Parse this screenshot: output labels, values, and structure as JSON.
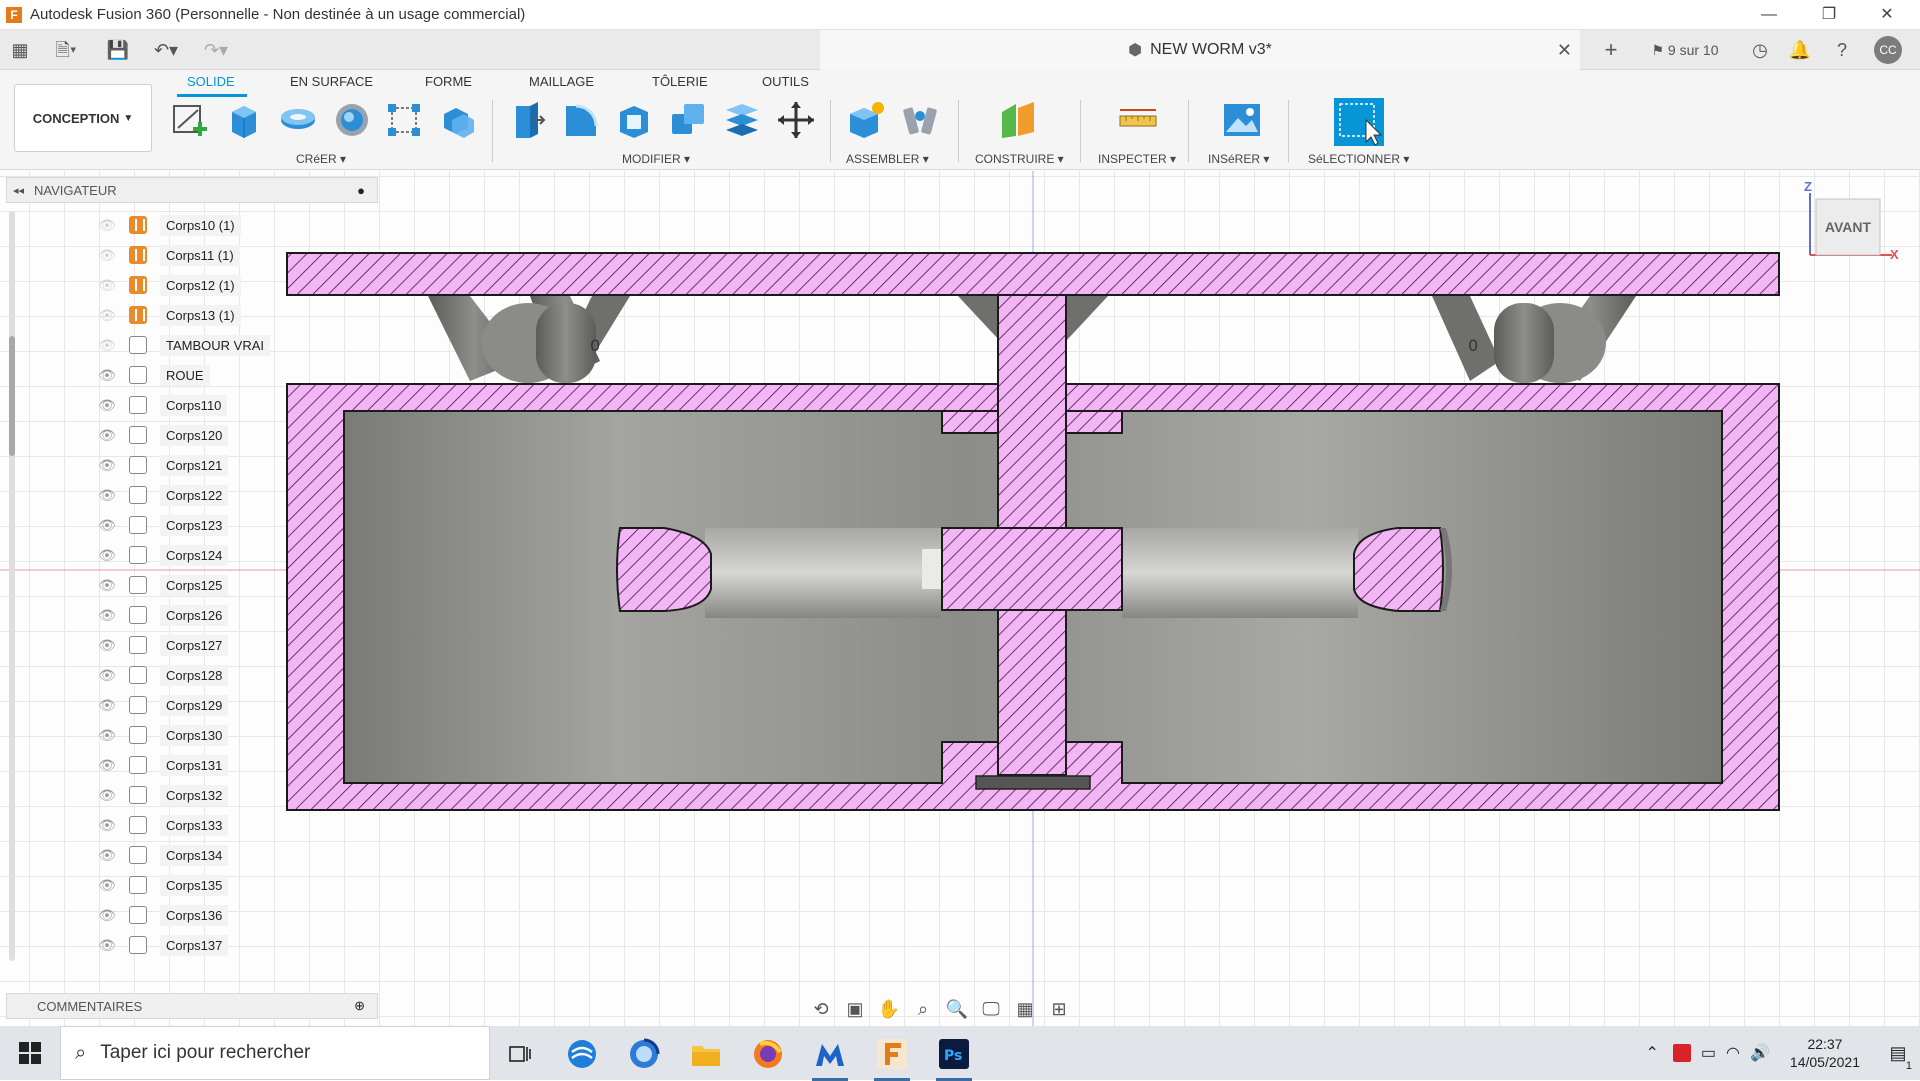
{
  "titlebar": {
    "app_logo": "F",
    "title": "Autodesk Fusion 360 (Personnelle - Non destinée à un usage commercial)"
  },
  "document": {
    "name": "NEW WORM v3*",
    "job_status": "9 sur 10",
    "user_initials": "CC"
  },
  "ribbon": {
    "workspace": "CONCEPTION",
    "tabs": [
      "SOLIDE",
      "EN SURFACE",
      "FORME",
      "MAILLAGE",
      "TÔLERIE",
      "OUTILS"
    ],
    "active_tab": "SOLIDE",
    "groups": [
      "CRéER",
      "MODIFIER",
      "ASSEMBLER",
      "CONSTRUIRE",
      "INSPECTER",
      "INSéRER",
      "SéLECTIONNER"
    ]
  },
  "navigator": {
    "title": "NAVIGATEUR",
    "items": [
      {
        "label": "Corps10 (1)",
        "visible": false,
        "icon": "component-body-icon"
      },
      {
        "label": "Corps11 (1)",
        "visible": false,
        "icon": "component-body-icon"
      },
      {
        "label": "Corps12 (1)",
        "visible": false,
        "icon": "component-body-icon"
      },
      {
        "label": "Corps13 (1)",
        "visible": false,
        "icon": "component-body-icon"
      },
      {
        "label": "TAMBOUR VRAI",
        "visible": false,
        "icon": "body-icon"
      },
      {
        "label": "ROUE",
        "visible": true,
        "icon": "body-icon"
      },
      {
        "label": "Corps110",
        "visible": true,
        "icon": "body-icon"
      },
      {
        "label": "Corps120",
        "visible": true,
        "icon": "body-icon"
      },
      {
        "label": "Corps121",
        "visible": true,
        "icon": "body-icon"
      },
      {
        "label": "Corps122",
        "visible": true,
        "icon": "body-icon"
      },
      {
        "label": "Corps123",
        "visible": true,
        "icon": "body-icon"
      },
      {
        "label": "Corps124",
        "visible": true,
        "icon": "body-icon"
      },
      {
        "label": "Corps125",
        "visible": true,
        "icon": "body-icon"
      },
      {
        "label": "Corps126",
        "visible": true,
        "icon": "body-icon"
      },
      {
        "label": "Corps127",
        "visible": true,
        "icon": "body-icon"
      },
      {
        "label": "Corps128",
        "visible": true,
        "icon": "body-icon"
      },
      {
        "label": "Corps129",
        "visible": true,
        "icon": "body-icon"
      },
      {
        "label": "Corps130",
        "visible": true,
        "icon": "body-icon"
      },
      {
        "label": "Corps131",
        "visible": true,
        "icon": "body-icon"
      },
      {
        "label": "Corps132",
        "visible": true,
        "icon": "body-icon"
      },
      {
        "label": "Corps133",
        "visible": true,
        "icon": "body-icon"
      },
      {
        "label": "Corps134",
        "visible": true,
        "icon": "body-icon"
      },
      {
        "label": "Corps135",
        "visible": true,
        "icon": "body-icon"
      },
      {
        "label": "Corps136",
        "visible": true,
        "icon": "body-icon"
      },
      {
        "label": "Corps137",
        "visible": true,
        "icon": "body-icon"
      }
    ]
  },
  "comments": {
    "title": "COMMENTAIRES"
  },
  "viewcube": {
    "face": "AVANT",
    "axis_z": "Z",
    "axis_x": "X"
  },
  "taskbar": {
    "search_placeholder": "Taper ici pour rechercher",
    "time": "22:37",
    "date": "14/05/2021",
    "notification_count": "1"
  },
  "colors": {
    "accent": "#0696d7",
    "section_fill": "#f3b5f5",
    "section_hatch": "#3a1a3a",
    "body_gray": "#8d8d8a"
  }
}
